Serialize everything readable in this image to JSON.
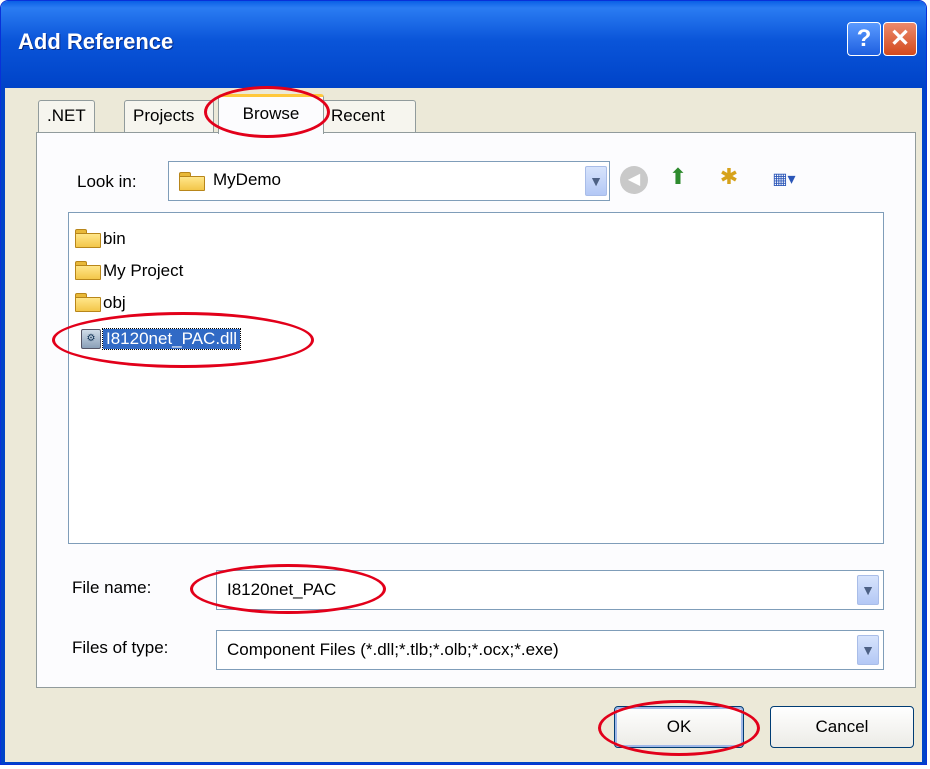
{
  "window": {
    "title": "Add Reference",
    "help_glyph": "?",
    "close_glyph": "✕"
  },
  "tabs": [
    {
      "label": ".NET",
      "active": false
    },
    {
      "label": "Projects",
      "active": false
    },
    {
      "label": "Browse",
      "active": true
    },
    {
      "label": "Recent",
      "active": false
    }
  ],
  "look_in": {
    "label": "Look in:",
    "value": "MyDemo"
  },
  "toolbar_icons": [
    "back-icon",
    "up-folder-icon",
    "new-folder-icon",
    "view-menu-icon"
  ],
  "files": [
    {
      "name": "bin",
      "type": "folder",
      "selected": false
    },
    {
      "name": "My Project",
      "type": "folder",
      "selected": false
    },
    {
      "name": "obj",
      "type": "folder",
      "selected": false
    },
    {
      "name": "I8120net_PAC.dll",
      "type": "dll",
      "selected": true
    }
  ],
  "file_name": {
    "label": "File name:",
    "value": "I8120net_PAC"
  },
  "file_type": {
    "label": "Files of type:",
    "value": "Component Files (*.dll;*.tlb;*.olb;*.ocx;*.exe)"
  },
  "buttons": {
    "ok": "OK",
    "cancel": "Cancel"
  },
  "colors": {
    "titlebar": "#0a55d9",
    "annotation": "#e2001a",
    "selection": "#316ac5"
  }
}
